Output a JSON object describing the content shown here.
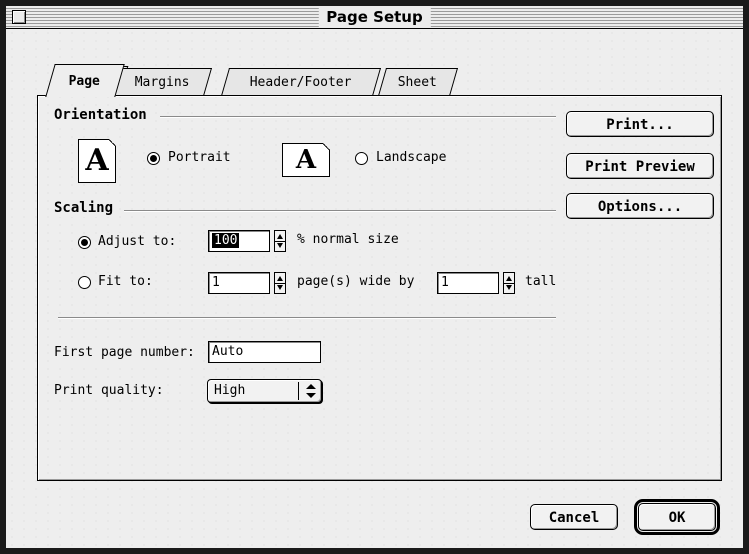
{
  "window": {
    "title": "Page Setup"
  },
  "tabs": [
    {
      "label": "Page",
      "active": true
    },
    {
      "label": "Margins",
      "active": false
    },
    {
      "label": "Header/Footer",
      "active": false
    },
    {
      "label": "Sheet",
      "active": false
    }
  ],
  "orientation": {
    "group_label": "Orientation",
    "portrait_label": "Portrait",
    "portrait_icon_letter": "A",
    "landscape_label": "Landscape",
    "landscape_icon_letter": "A",
    "selected": "Portrait"
  },
  "scaling": {
    "group_label": "Scaling",
    "adjust_label": "Adjust to:",
    "adjust_value": "100",
    "adjust_suffix": "% normal size",
    "fit_label": "Fit to:",
    "fit_wide_value": "1",
    "fit_wide_suffix": "page(s) wide by",
    "fit_tall_value": "1",
    "fit_tall_suffix": "tall",
    "selected": "Adjust to:"
  },
  "first_page_number": {
    "label": "First page number:",
    "value": "Auto"
  },
  "print_quality": {
    "label": "Print quality:",
    "value": "High"
  },
  "side_buttons": {
    "print": "Print...",
    "print_preview": "Print Preview",
    "options": "Options..."
  },
  "footer_buttons": {
    "cancel": "Cancel",
    "ok": "OK"
  }
}
